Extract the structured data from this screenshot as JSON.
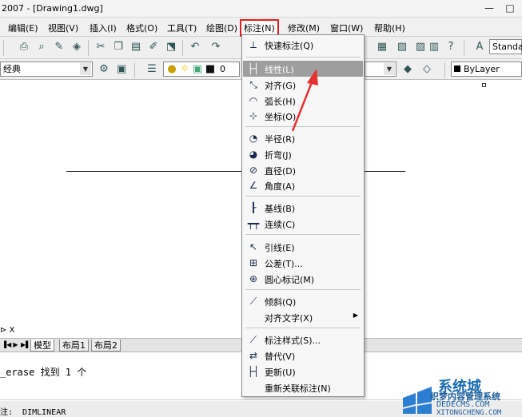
{
  "window": {
    "title": "2007 - [Drawing1.dwg]",
    "minimize": "—",
    "restore": "□"
  },
  "menubar": {
    "items": [
      {
        "label": "编辑(E)"
      },
      {
        "label": "视图(V)"
      },
      {
        "label": "插入(I)"
      },
      {
        "label": "格式(O)"
      },
      {
        "label": "工具(T)"
      },
      {
        "label": "绘图(D)"
      },
      {
        "label": "标注(N)"
      },
      {
        "label": "修改(M)"
      },
      {
        "label": "窗口(W)"
      },
      {
        "label": "帮助(H)"
      }
    ],
    "active": "标注(N)",
    "accent_color": "#e02020"
  },
  "toolbar": {
    "text_style": "Standa",
    "workspace": "经典",
    "layer": "0",
    "linetype": "ByLayer"
  },
  "dimension_menu": {
    "items": [
      {
        "label": "快速标注(Q)",
        "icon": "quick-dimension-icon",
        "glyph": "⟂"
      },
      {
        "label": "线性(L)",
        "icon": "linear-dimension-icon",
        "glyph": "├┤",
        "highlighted": true
      },
      {
        "label": "对齐(G)",
        "icon": "aligned-dimension-icon",
        "glyph": "⤡"
      },
      {
        "label": "弧长(H)",
        "icon": "arc-length-icon",
        "glyph": "◠"
      },
      {
        "label": "坐标(O)",
        "icon": "ordinate-icon",
        "glyph": "⊹"
      },
      {
        "label": "半径(R)",
        "icon": "radius-icon",
        "glyph": "◔"
      },
      {
        "label": "折弯(J)",
        "icon": "jogged-icon",
        "glyph": "◕"
      },
      {
        "label": "直径(D)",
        "icon": "diameter-icon",
        "glyph": "⊘"
      },
      {
        "label": "角度(A)",
        "icon": "angular-icon",
        "glyph": "∠"
      },
      {
        "label": "基线(B)",
        "icon": "baseline-icon",
        "glyph": "┠"
      },
      {
        "label": "连续(C)",
        "icon": "continue-icon",
        "glyph": "┯┯"
      },
      {
        "label": "引线(E)",
        "icon": "leader-icon",
        "glyph": "↖"
      },
      {
        "label": "公差(T)...",
        "icon": "tolerance-icon",
        "glyph": "⊞"
      },
      {
        "label": "圆心标记(M)",
        "icon": "center-mark-icon",
        "glyph": "⊕"
      },
      {
        "label": "倾斜(Q)",
        "icon": "oblique-icon",
        "glyph": "⟋"
      },
      {
        "label": "对齐文字(X)",
        "icon": "",
        "glyph": "",
        "submenu": true
      },
      {
        "label": "标注样式(S)...",
        "icon": "dimension-style-icon",
        "glyph": "⟋"
      },
      {
        "label": "替代(V)",
        "icon": "override-icon",
        "glyph": "⇄"
      },
      {
        "label": "更新(U)",
        "icon": "update-icon",
        "glyph": "├┤"
      },
      {
        "label": "重新关联标注(N)",
        "icon": "",
        "glyph": ""
      }
    ],
    "highlight_color": "#9e9e9e"
  },
  "layout_tabs": {
    "ucs_label": "X",
    "tabs": [
      "模型",
      "布局1",
      "布局2"
    ],
    "active": "模型"
  },
  "command_line": {
    "line1": "_erase 找到 1 个"
  },
  "status_bar": {
    "text": "注:  DIMLINEAR"
  },
  "watermark": {
    "brand": "系统城",
    "site_name": "织梦内容管理系统",
    "url1": "DEDECMS.COM",
    "url2": "XITONGCHENG.COM"
  }
}
